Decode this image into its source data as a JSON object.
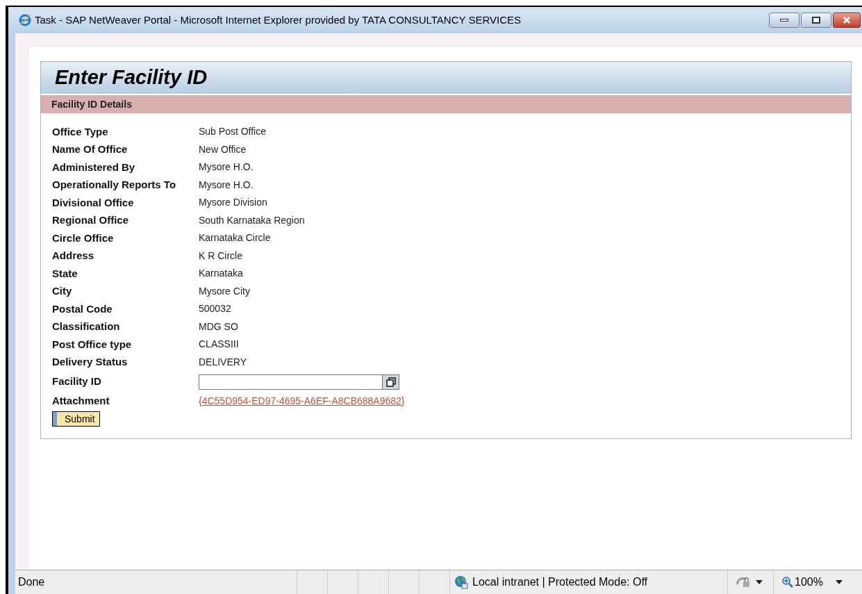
{
  "window": {
    "title": "Task - SAP NetWeaver Portal - Microsoft Internet Explorer provided by TATA CONSULTANCY SERVICES"
  },
  "page": {
    "title": "Enter Facility ID",
    "section": "Facility ID Details",
    "fields": [
      {
        "label": "Office Type",
        "value": "Sub Post Office"
      },
      {
        "label": "Name Of Office",
        "value": "New Office"
      },
      {
        "label": "Administered By",
        "value": "Mysore H.O."
      },
      {
        "label": "Operationally Reports To",
        "value": "Mysore H.O."
      },
      {
        "label": "Divisional Office",
        "value": "Mysore Division"
      },
      {
        "label": "Regional Office",
        "value": "South Karnataka Region"
      },
      {
        "label": "Circle Office",
        "value": "Karnataka Circle"
      },
      {
        "label": "Address",
        "value": "K R Circle"
      },
      {
        "label": "State",
        "value": "Karnataka"
      },
      {
        "label": "City",
        "value": "Mysore City"
      },
      {
        "label": "Postal Code",
        "value": "500032"
      },
      {
        "label": "Classification",
        "value": "MDG SO"
      },
      {
        "label": "Post Office type",
        "value": "CLASSIII"
      },
      {
        "label": "Delivery Status",
        "value": "DELIVERY"
      }
    ],
    "facility_id": {
      "label": "Facility ID"
    },
    "attachment": {
      "label": "Attachment",
      "link": "{4C55D954-ED97-4695-A6EF-A8CB688A9682}"
    },
    "submit": "Submit"
  },
  "status_bar": {
    "status": "Done",
    "zone": "Local intranet | Protected Mode: Off",
    "zoom": "100%"
  }
}
